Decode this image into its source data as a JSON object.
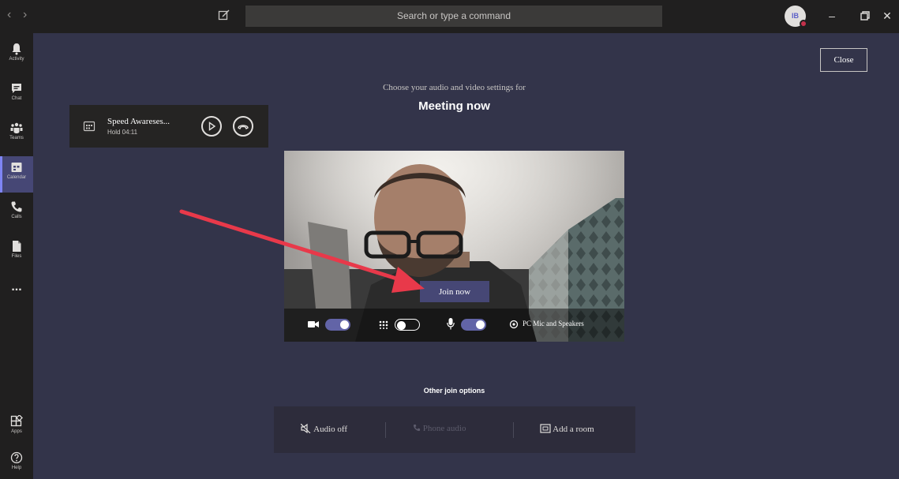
{
  "titlebar": {
    "back_icon": "chevron-left-icon",
    "forward_icon": "chevron-right-icon",
    "search_placeholder": "Search or type a command",
    "avatar_initials": "IB",
    "minimize": "–",
    "close": "✕"
  },
  "rail": {
    "items": [
      {
        "label": "Activity",
        "icon": "bell-icon"
      },
      {
        "label": "Chat",
        "icon": "chat-icon"
      },
      {
        "label": "Teams",
        "icon": "teams-icon"
      },
      {
        "label": "Calendar",
        "icon": "calendar-icon"
      },
      {
        "label": "Calls",
        "icon": "phone-icon"
      },
      {
        "label": "Files",
        "icon": "file-icon"
      },
      {
        "label": "Apps",
        "icon": "apps-icon"
      },
      {
        "label": "Help",
        "icon": "help-icon"
      }
    ],
    "more": "..."
  },
  "hold_card": {
    "name": "Speed Awareses...",
    "status": "Hold  04:11"
  },
  "prejoin": {
    "prompt": "Choose your audio and video settings for",
    "title": "Meeting now",
    "close_label": "Close",
    "join_label": "Join now",
    "audio_device": "PC Mic and Speakers",
    "camera_on": true,
    "blur_on": false,
    "mic_on": true
  },
  "other_options": {
    "heading": "Other join options",
    "audio_off": "Audio off",
    "phone_audio": "Phone audio",
    "add_room": "Add a room"
  },
  "colors": {
    "background": "#33344a",
    "rail": "#201f1f",
    "accent": "#6264a7",
    "annotation_arrow": "#e8394a"
  }
}
